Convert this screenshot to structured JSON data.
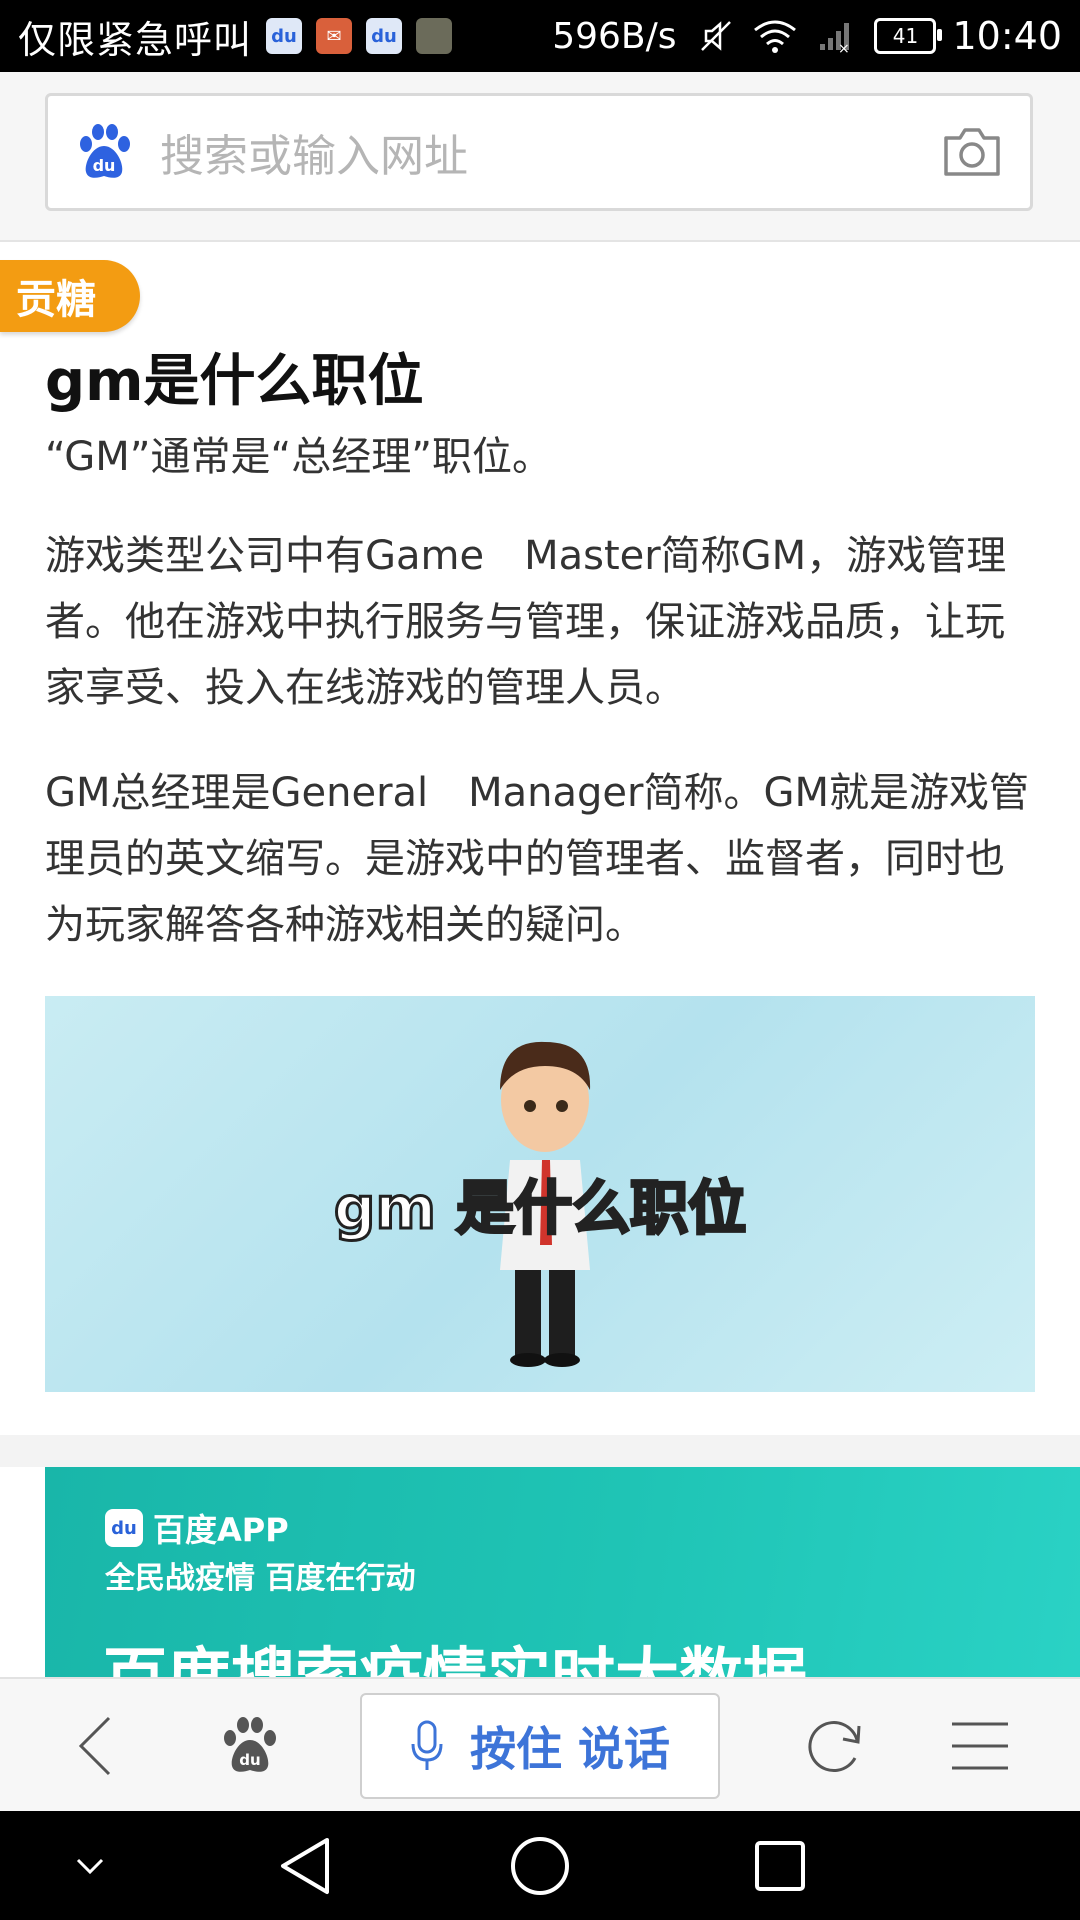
{
  "status_bar": {
    "carrier": "仅限紧急呼叫",
    "net_speed": "596B/s",
    "battery": "41",
    "time": "10:40",
    "notification_icons": [
      "baidu-icon",
      "mail-icon",
      "baidu-icon",
      "photo-icon"
    ]
  },
  "search": {
    "placeholder": "搜索或输入网址"
  },
  "article": {
    "badge": "贡糖",
    "title": "gm是什么职位",
    "summary": "“GM”通常是“总经理”职位。",
    "paragraphs": [
      "游戏类型公司中有Game　Master简称GM，游戏管理者。他在游戏中执行服务与管理，保证游戏品质，让玩家享受、投入在线游戏的管理人员。",
      "GM总经理是General　Manager简称。GM就是游戏管理员的英文缩写。是游戏中的管理者、监督者，同时也为玩家解答各种游戏相关的疑问。"
    ],
    "video_caption": "gm 是什么职位"
  },
  "banner": {
    "app_name": "百度APP",
    "slogan": "全民战疫情 百度在行动",
    "headline": "百度搜索疫情实时大数据"
  },
  "toolbar": {
    "voice_label": "按住 说话"
  },
  "colors": {
    "accent_blue": "#3d74d8",
    "badge_orange": "#f39c12",
    "banner_teal": "#1fc4b5"
  }
}
